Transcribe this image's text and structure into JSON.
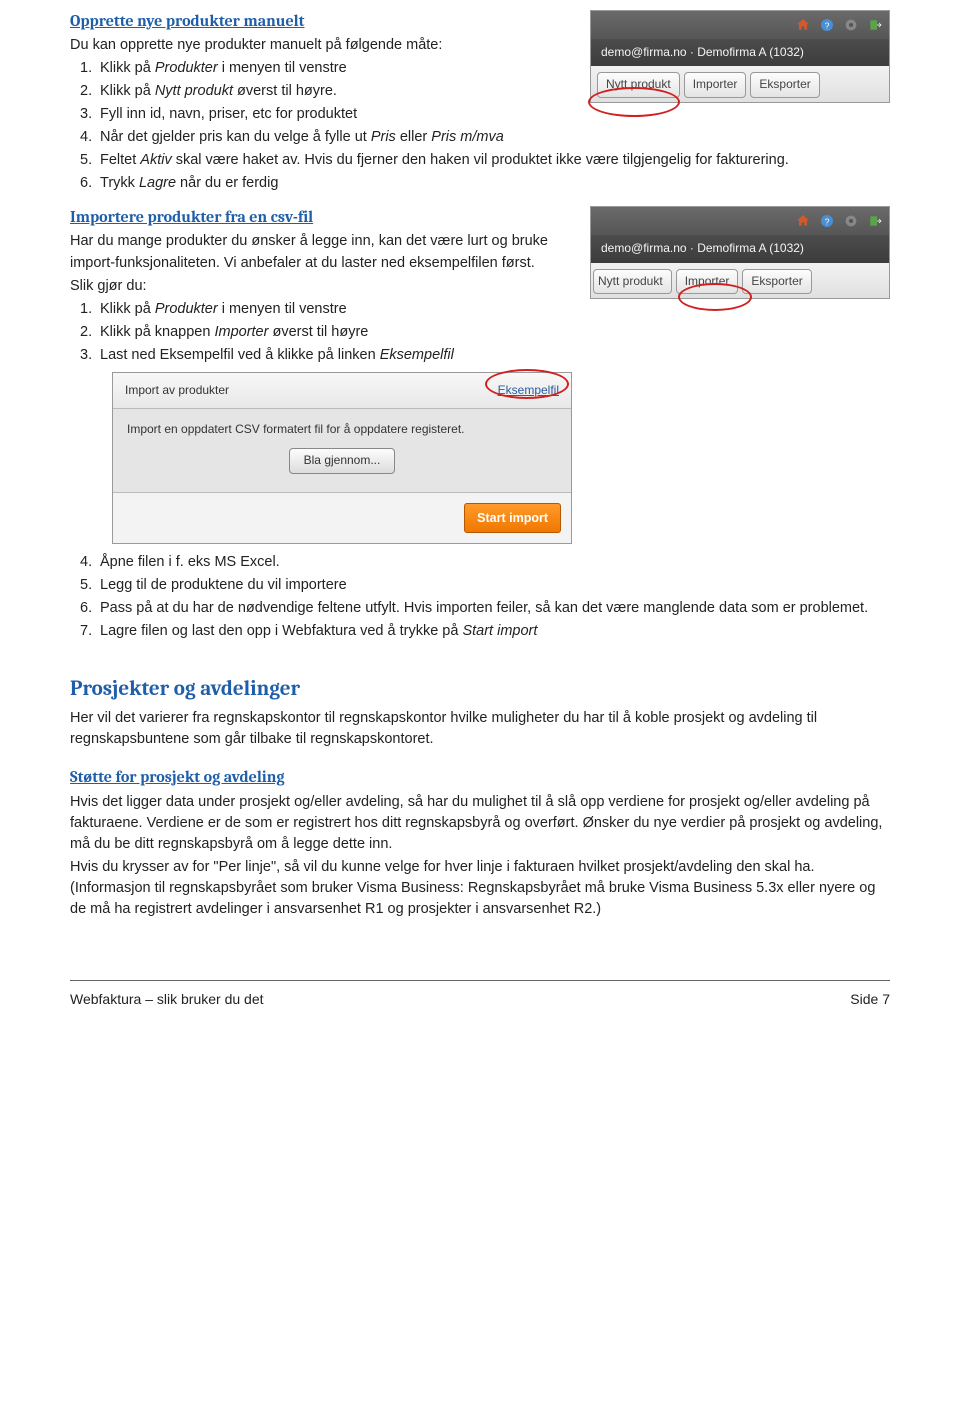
{
  "sec1": {
    "heading": "Opprette nye produkter manuelt",
    "intro": "Du kan opprette nye produkter manuelt på følgende måte:",
    "steps": [
      {
        "n": "1.",
        "text_a": "Klikk på ",
        "i": "Produkter",
        "text_b": " i menyen til venstre"
      },
      {
        "n": "2.",
        "text_a": "Klikk på ",
        "i": "Nytt produkt",
        "text_b": " øverst til høyre."
      },
      {
        "n": "3.",
        "text_a": "Fyll inn id, navn, priser, etc for produktet",
        "i": "",
        "text_b": ""
      },
      {
        "n": "4.",
        "text_a": "Når det gjelder pris kan du velge å fylle ut ",
        "i": "Pris",
        "text_b": " eller ",
        "i2": "Pris m/mva",
        "text_c": ""
      },
      {
        "n": "5.",
        "text_a": "Feltet ",
        "i": "Aktiv",
        "text_b": " skal være haket av. Hvis du fjerner den haken vil produktet ikke være tilgjengelig for fakturering."
      },
      {
        "n": "6.",
        "text_a": "Trykk ",
        "i": "Lagre",
        "text_b": " når du er ferdig"
      }
    ]
  },
  "sec2": {
    "heading": "Importere produkter fra en csv-fil",
    "p1": "Har du mange produkter du ønsker å legge inn, kan det være lurt og bruke import-funksjonaliteten. Vi anbefaler at du laster ned eksempelfilen først.",
    "p2": "Slik gjør du:",
    "steps": [
      {
        "n": "1.",
        "text_a": "Klikk på ",
        "i": "Produkter",
        "text_b": " i menyen til venstre"
      },
      {
        "n": "2.",
        "text_a": "Klikk på knappen ",
        "i": "Importer",
        "text_b": " øverst til høyre"
      },
      {
        "n": "3.",
        "text_a": "Last ned Eksempelfil ved å klikke på linken ",
        "i": "Eksempelfil",
        "text_b": ""
      }
    ],
    "steps_b": [
      {
        "n": "4.",
        "text_a": "Åpne filen i f. eks MS Excel.",
        "i": "",
        "text_b": ""
      },
      {
        "n": "5.",
        "text_a": "Legg til de produktene du vil importere",
        "i": "",
        "text_b": ""
      },
      {
        "n": "6.",
        "text_a": "Pass på at du har de nødvendige feltene utfylt. Hvis importen feiler, så kan det være manglende data som er problemet.",
        "i": "",
        "text_b": ""
      },
      {
        "n": "7.",
        "text_a": "Lagre filen og last den opp i Webfaktura ved å trykke på ",
        "i": "Start import",
        "text_b": ""
      }
    ]
  },
  "sec3": {
    "heading": "Prosjekter og avdelinger",
    "p1": "Her vil det varierer fra regnskapskontor til regnskapskontor hvilke muligheter du har til å koble prosjekt og avdeling til regnskapsbuntene som går tilbake til regnskapskontoret."
  },
  "sec4": {
    "heading": "Støtte for prosjekt og avdeling",
    "p1": "Hvis det ligger data under prosjekt og/eller avdeling, så har du mulighet til å slå opp verdiene for prosjekt og/eller avdeling på fakturaene. Verdiene er de som er registrert hos ditt regnskapsbyrå og overført. Ønsker du nye verdier på prosjekt og avdeling, må du be ditt regnskapsbyrå om å legge dette inn.",
    "p2": "Hvis du krysser av for \"Per linje\", så vil du kunne velge for hver linje i fakturaen hvilket prosjekt/avdeling den skal ha. (Informasjon til regnskapsbyrået som bruker Visma Business: Regnskapsbyrået må bruke Visma Business 5.3x eller nyere og de må ha registrert avdelinger i ansvarsenhet R1 og prosjekter i ansvarsenhet R2.)"
  },
  "shot": {
    "userline": "demo@firma.no · Demofirma A (1032)",
    "tab1": "Nytt produkt",
    "tab2": "Importer",
    "tab3": "Eksporter"
  },
  "importbox": {
    "title": "Import av produkter",
    "link": "Eksempelfil",
    "desc": "Import en oppdatert CSV formatert fil for å oppdatere registeret.",
    "browse": "Bla gjennom...",
    "start": "Start import"
  },
  "footer": {
    "left": "Webfaktura – slik bruker du det",
    "right": "Side 7"
  }
}
